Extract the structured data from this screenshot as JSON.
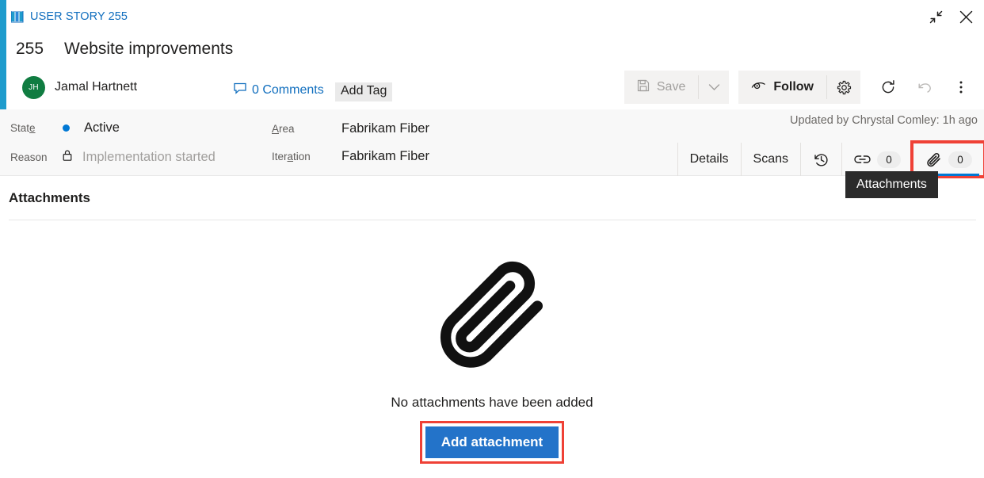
{
  "window": {
    "type_label": "USER STORY 255",
    "type_icon": "user-story-icon",
    "restore_icon": "restore-window-icon",
    "close_icon": "close-icon"
  },
  "header": {
    "work_item_id": "255",
    "title": "Website improvements",
    "assignee": {
      "initials": "JH",
      "name": "Jamal Hartnett",
      "avatar_color": "#107c41"
    },
    "comments_label": "0 Comments",
    "comments_icon": "comment-bubble-icon",
    "add_tag_label": "Add Tag"
  },
  "toolbar": {
    "save_label": "Save",
    "save_icon": "save-disk-icon",
    "save_dropdown_icon": "chevron-down-icon",
    "follow_label": "Follow",
    "follow_icon": "eye-icon",
    "settings_icon": "gear-icon",
    "refresh_icon": "refresh-icon",
    "revert_icon": "undo-icon",
    "more_icon": "more-kebab-icon"
  },
  "fields": {
    "state": {
      "label": "State",
      "label_pre": "Stat",
      "label_key": "e",
      "label_post": "",
      "value": "Active",
      "dot_color": "#0078d4"
    },
    "reason": {
      "label": "Reason",
      "value": "Implementation started",
      "locked": true,
      "lock_icon": "lock-icon"
    },
    "area": {
      "label": "Area",
      "label_pre": "",
      "label_key": "A",
      "label_post": "rea",
      "value": "Fabrikam Fiber"
    },
    "iteration": {
      "label": "Iteration",
      "label_pre": "Iter",
      "label_key": "a",
      "label_post": "tion",
      "value": "Fabrikam Fiber"
    },
    "updated_by": "Updated by Chrystal Comley: 1h ago"
  },
  "tabs": [
    {
      "label": "Details",
      "name": "tab-details"
    },
    {
      "label": "Scans",
      "name": "tab-scans"
    },
    {
      "label": "",
      "icon": "history-icon",
      "name": "tab-history"
    },
    {
      "label": "",
      "icon": "link-icon",
      "count": "0",
      "name": "tab-links"
    },
    {
      "label": "",
      "icon": "attachment-paperclip-icon",
      "count": "0",
      "name": "tab-attachments",
      "active": true,
      "highlighted": true
    }
  ],
  "tooltip": {
    "text": "Attachments"
  },
  "attachments_section": {
    "title": "Attachments",
    "empty_icon": "large-paperclip-icon",
    "empty_text": "No attachments have been added",
    "add_button_label": "Add attachment",
    "add_button_color": "#2373c9",
    "highlight_color": "#ef4136"
  }
}
